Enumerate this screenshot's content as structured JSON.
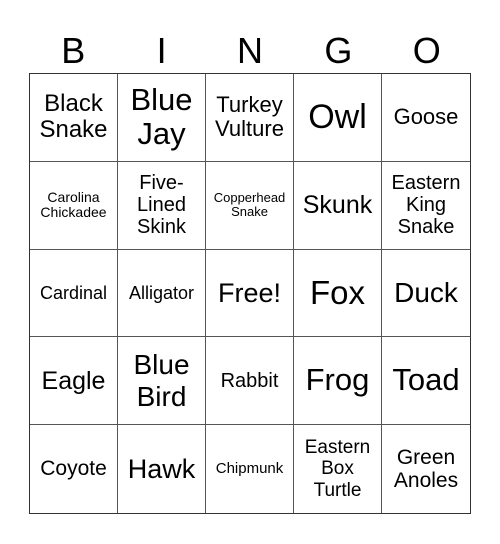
{
  "header": {
    "letters": [
      "B",
      "I",
      "N",
      "G",
      "O"
    ]
  },
  "cells": [
    "Black Snake",
    "Blue Jay",
    "Turkey Vulture",
    "Owl",
    "Goose",
    "Carolina Chickadee",
    "Five-Lined Skink",
    "Copperhead Snake",
    "Skunk",
    "Eastern King Snake",
    "Cardinal",
    "Alligator",
    "Free!",
    "Fox",
    "Duck",
    "Eagle",
    "Blue Bird",
    "Rabbit",
    "Frog",
    "Toad",
    "Coyote",
    "Hawk",
    "Chipmunk",
    "Eastern Box Turtle",
    "Green Anoles"
  ]
}
